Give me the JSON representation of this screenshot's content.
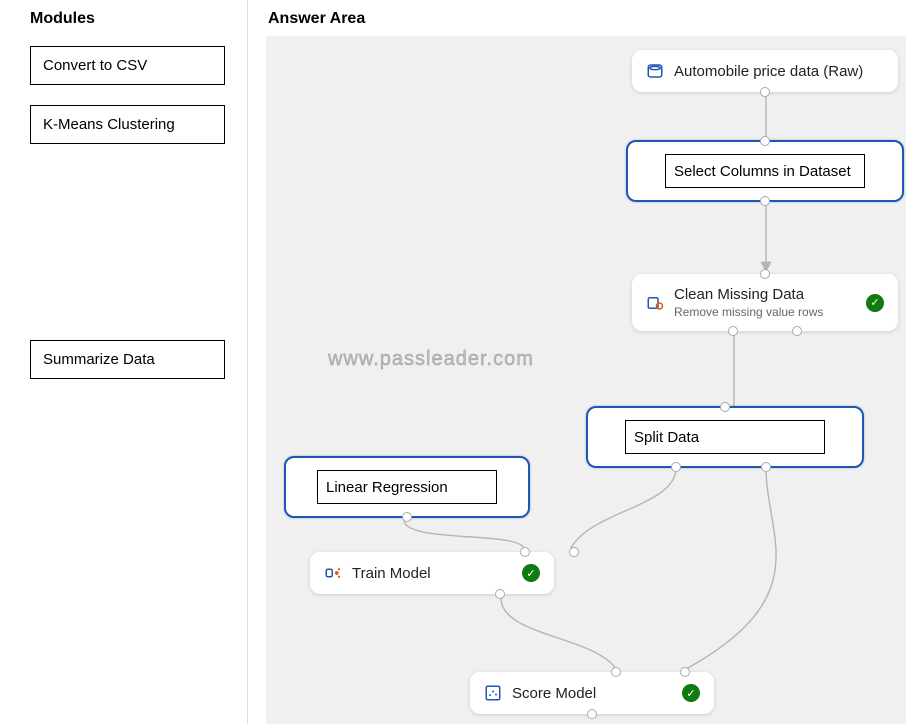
{
  "left": {
    "title": "Modules",
    "items": [
      "Convert to CSV",
      "K-Means Clustering",
      "Summarize Data"
    ]
  },
  "answerTitle": "Answer Area",
  "watermark": "www.passleader.com",
  "nodes": {
    "raw": {
      "label": "Automobile price data (Raw)"
    },
    "select": {
      "answer": "Select Columns in Dataset"
    },
    "clean": {
      "label": "Clean Missing Data",
      "sub": "Remove missing value rows"
    },
    "split": {
      "answer": "Split Data"
    },
    "linreg": {
      "answer": "Linear Regression"
    },
    "train": {
      "label": "Train Model"
    },
    "score": {
      "label": "Score Model"
    }
  }
}
